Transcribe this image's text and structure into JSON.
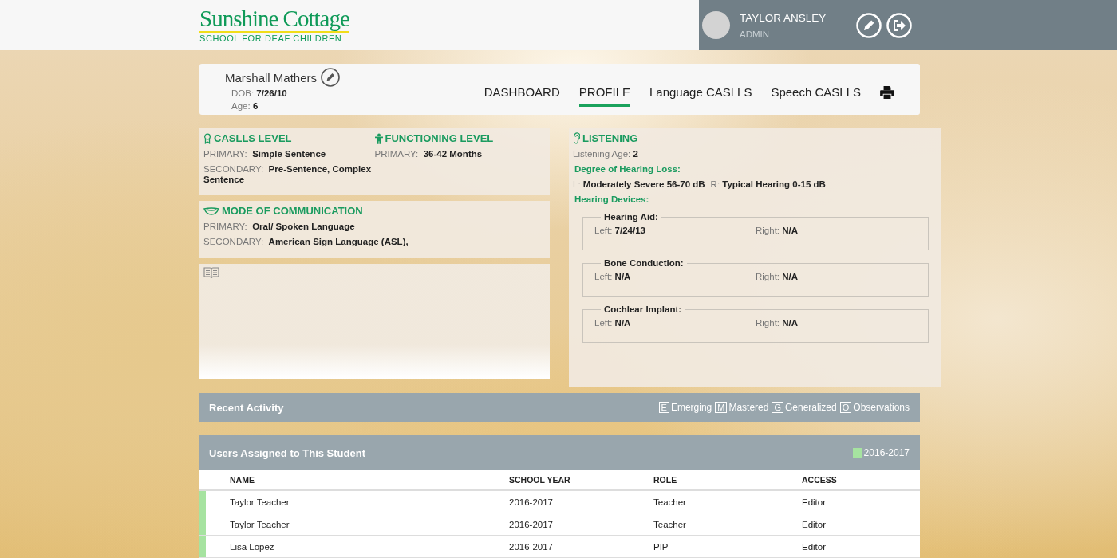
{
  "header": {
    "logo": {
      "name": "Sunshine Cottage",
      "tagline": "SCHOOL FOR DEAF CHILDREN"
    },
    "user": {
      "name": "TAYLOR ANSLEY",
      "role": "ADMIN"
    }
  },
  "student": {
    "name": "Marshall Mathers",
    "fields": [
      {
        "label": "DOB:",
        "value": "7/26/10"
      },
      {
        "label": "Age:",
        "value": "6"
      }
    ]
  },
  "tabs": [
    {
      "label": "DASHBOARD",
      "selected": false
    },
    {
      "label": "PROFILE",
      "selected": true
    },
    {
      "label": "Language CASLLS",
      "selected": false
    },
    {
      "label": "Speech CASLLS",
      "selected": false
    }
  ],
  "level_panels": [
    {
      "kind": "caslls",
      "title": "CASLLS LEVEL",
      "fields": [
        {
          "label": "PRIMARY:",
          "value": "Simple Sentence"
        },
        {
          "label": "SECONDARY:",
          "value": "Pre-Sentence, Complex Sentence"
        }
      ]
    },
    {
      "kind": "functioning",
      "title": "FUNCTIONING LEVEL",
      "fields": [
        {
          "label": "PRIMARY:",
          "value": "36-42 Months"
        }
      ]
    }
  ],
  "communication": {
    "title": "MODE OF COMMUNICATION",
    "fields": [
      {
        "label": "PRIMARY:",
        "value": "Oral/ Spoken Language"
      },
      {
        "label": "SECONDARY:",
        "value": "American Sign Language (ASL),"
      }
    ]
  },
  "listening": {
    "title": "LISTENING",
    "age": {
      "label": "Listening Age:",
      "value": "2"
    },
    "loss_heading": "Degree of Hearing Loss:",
    "loss": [
      {
        "label": "L:",
        "value": "Moderately Severe 56-70 dB"
      },
      {
        "label": "R:",
        "value": "Typical Hearing 0-15 dB"
      }
    ],
    "devices_heading": "Hearing Devices:",
    "devices": [
      {
        "title": "Hearing Aid:",
        "left": {
          "label": "Left:",
          "value": "7/24/13"
        },
        "right": {
          "label": "Right:",
          "value": "N/A"
        }
      },
      {
        "title": "Bone Conduction:",
        "left": {
          "label": "Left:",
          "value": "N/A"
        },
        "right": {
          "label": "Right:",
          "value": "N/A"
        }
      },
      {
        "title": "Cochlear Implant:",
        "left": {
          "label": "Left:",
          "value": "N/A"
        },
        "right": {
          "label": "Right:",
          "value": "N/A"
        }
      }
    ]
  },
  "recent_activity": {
    "title": "Recent Activity",
    "legend": [
      {
        "letter": "E",
        "label": "Emerging"
      },
      {
        "letter": "M",
        "label": "Mastered"
      },
      {
        "letter": "G",
        "label": "Generalized"
      },
      {
        "letter": "O",
        "label": "Observations"
      }
    ]
  },
  "users": {
    "title": "Users Assigned to This Student",
    "legend": {
      "color": "#a6e3a0",
      "label": "2016-2017"
    },
    "columns": [
      "NAME",
      "SCHOOL YEAR",
      "ROLE",
      "ACCESS"
    ],
    "rows": [
      {
        "color": "#a6e3a0",
        "cells": [
          "Taylor Teacher",
          "2016-2017",
          "Teacher",
          "Editor"
        ]
      },
      {
        "color": "#a6e3a0",
        "cells": [
          "Taylor Teacher",
          "2016-2017",
          "Teacher",
          "Editor"
        ]
      },
      {
        "color": "#a6e3a0",
        "cells": [
          "Lisa Lopez",
          "2016-2017",
          "PIP",
          "Editor"
        ]
      }
    ]
  }
}
